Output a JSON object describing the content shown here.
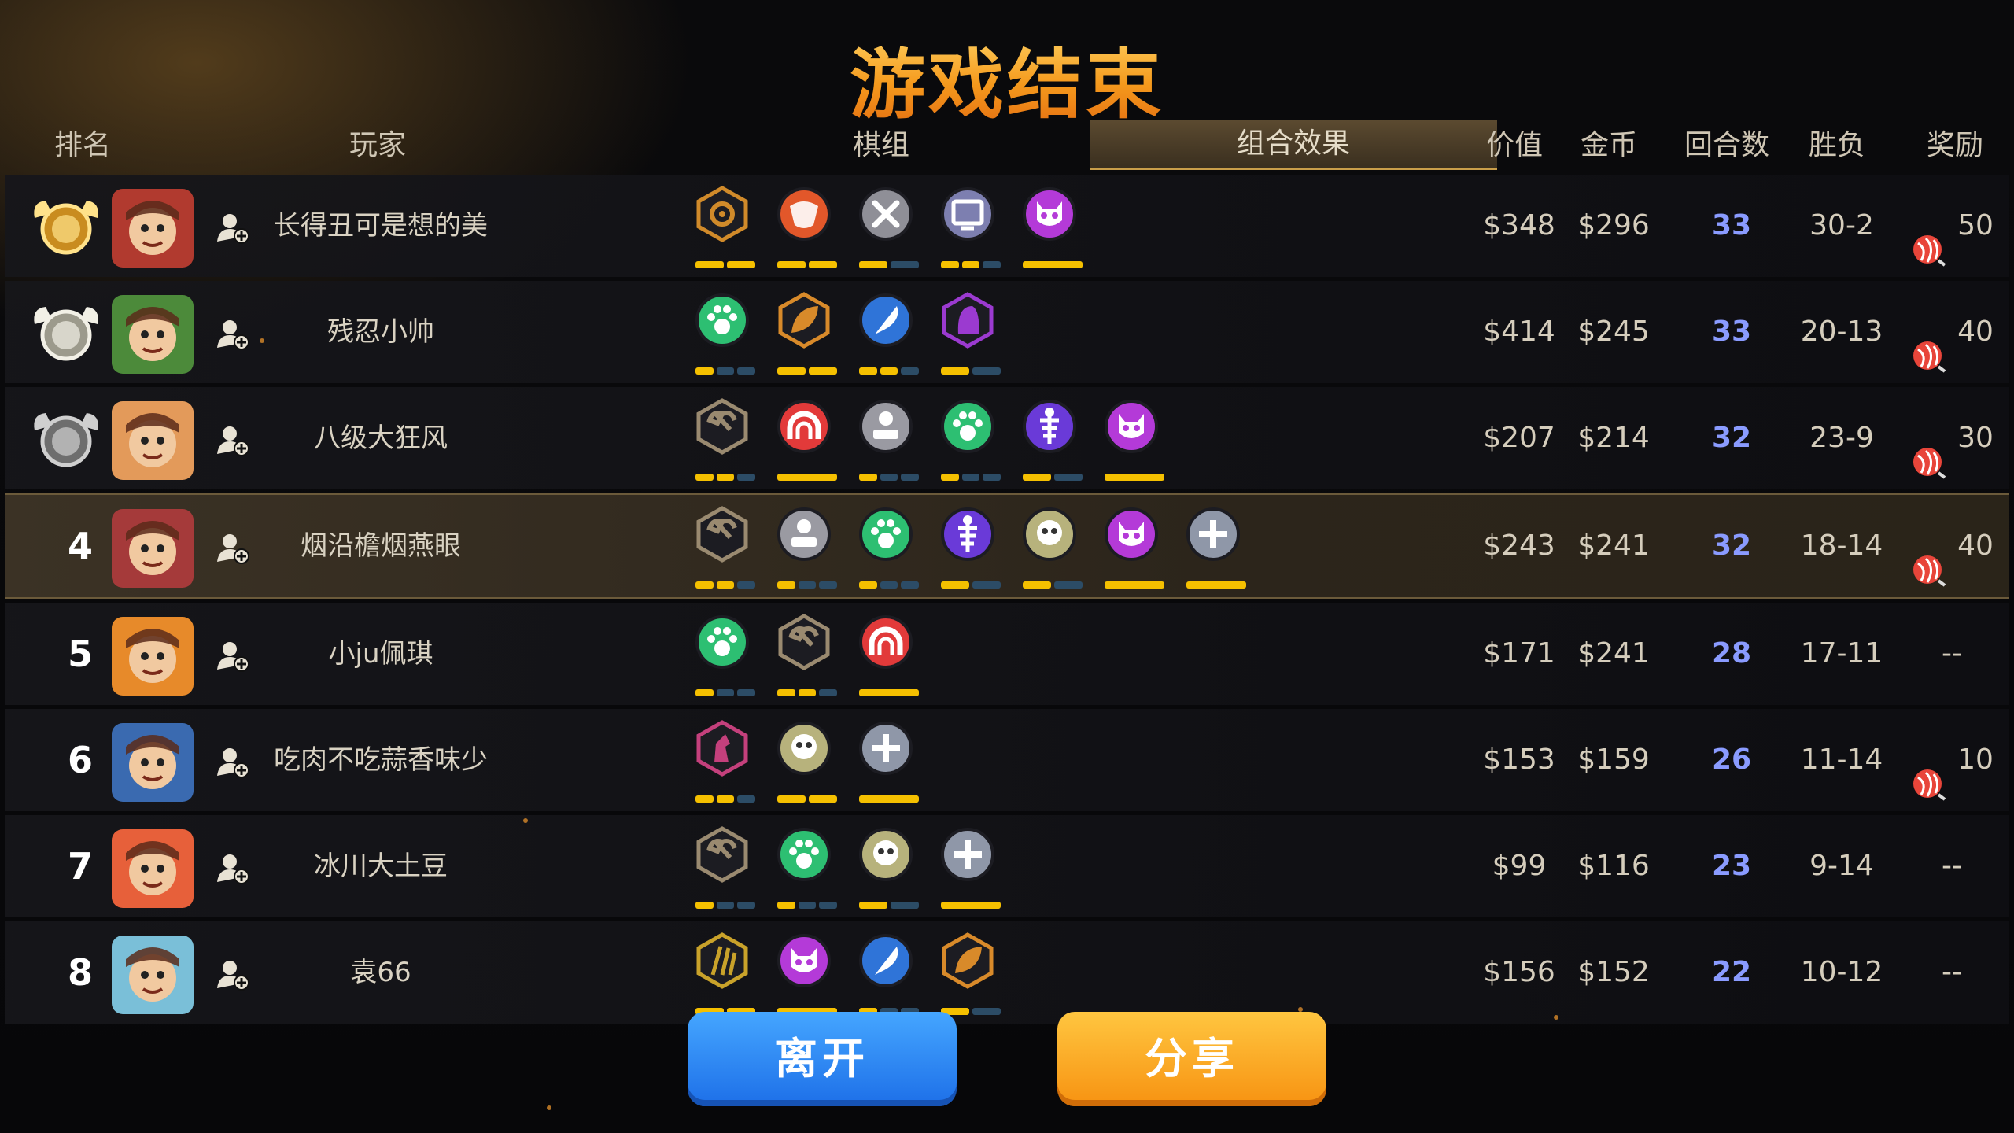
{
  "title": "游戏结束",
  "headers": {
    "rank": "排名",
    "player": "玩家",
    "pieces": "棋组",
    "combo": "组合效果",
    "value": "价值",
    "gold": "金币",
    "rounds": "回合数",
    "winloss": "胜负",
    "reward": "奖励"
  },
  "colors": {
    "accent": "#f59a1d",
    "round_text": "#8a9bff",
    "bar_on": "#f5c000",
    "bar_off": "#2c4c66",
    "leave_button": "#1d6fe8",
    "share_button": "#f79211"
  },
  "rows": [
    {
      "rank": "1",
      "rank_icon": "gold-medal-icon",
      "name": "长得丑可是想的美",
      "value": "$348",
      "gold": "$296",
      "rounds": "33",
      "winloss": "30-2",
      "reward": "50",
      "has_reward": true,
      "pieces": [
        {
          "icon": "gear-icon",
          "color": "#d08a2a",
          "shape": "hex",
          "bars": [
            2,
            2
          ]
        },
        {
          "icon": "demon-horn-icon",
          "color": "#e2572a",
          "shape": "circle",
          "bars": [
            2,
            2
          ]
        },
        {
          "icon": "crossed-tools-icon",
          "color": "#8f8f97",
          "shape": "circle",
          "bars": [
            1,
            2
          ]
        },
        {
          "icon": "monitor-icon",
          "color": "#7d7fb0",
          "shape": "circle",
          "bars": [
            2,
            3
          ]
        },
        {
          "icon": "demon-face-icon",
          "color": "#b43ad8",
          "shape": "circle",
          "bars": [
            1,
            1
          ]
        }
      ]
    },
    {
      "rank": "2",
      "rank_icon": "silver-medal-icon",
      "name": "残忍小帅",
      "value": "$414",
      "gold": "$245",
      "rounds": "33",
      "winloss": "20-13",
      "reward": "40",
      "has_reward": true,
      "pieces": [
        {
          "icon": "paw-icon",
          "color": "#2dbf72",
          "shape": "circle",
          "bars": [
            1,
            3
          ]
        },
        {
          "icon": "leaf-icon",
          "color": "#d88a2a",
          "shape": "hex",
          "bars": [
            2,
            2
          ]
        },
        {
          "icon": "feather-icon",
          "color": "#2f74d8",
          "shape": "circle",
          "bars": [
            2,
            3
          ]
        },
        {
          "icon": "hood-icon",
          "color": "#9b3ad0",
          "shape": "hex",
          "bars": [
            1,
            2
          ]
        }
      ]
    },
    {
      "rank": "3",
      "rank_icon": "bronze-medal-icon",
      "name": "八级大狂风",
      "value": "$207",
      "gold": "$214",
      "rounds": "32",
      "winloss": "23-9",
      "reward": "30",
      "has_reward": true,
      "pieces": [
        {
          "icon": "axe-icon",
          "color": "#9a8a70",
          "shape": "hex",
          "bars": [
            2,
            3
          ]
        },
        {
          "icon": "arch-icon",
          "color": "#e23a3a",
          "shape": "circle",
          "bars": [
            1,
            1
          ]
        },
        {
          "icon": "pedestal-icon",
          "color": "#9a9aa2",
          "shape": "circle",
          "bars": [
            1,
            3
          ]
        },
        {
          "icon": "paw-icon",
          "color": "#2dbf72",
          "shape": "circle",
          "bars": [
            1,
            3
          ]
        },
        {
          "icon": "fishbone-icon",
          "color": "#6a3ad8",
          "shape": "circle",
          "bars": [
            1,
            2
          ]
        },
        {
          "icon": "demon-face-icon",
          "color": "#b43ad8",
          "shape": "circle",
          "bars": [
            1,
            1
          ]
        }
      ]
    },
    {
      "rank": "4",
      "rank_icon": "",
      "name": "烟沿檐烟燕眼",
      "value": "$243",
      "gold": "$241",
      "rounds": "32",
      "winloss": "18-14",
      "reward": "40",
      "has_reward": true,
      "pieces": [
        {
          "icon": "axe-icon",
          "color": "#9a8a70",
          "shape": "hex",
          "bars": [
            2,
            3
          ]
        },
        {
          "icon": "pedestal-icon",
          "color": "#9a9aa2",
          "shape": "circle",
          "bars": [
            1,
            3
          ]
        },
        {
          "icon": "paw-icon",
          "color": "#2dbf72",
          "shape": "circle",
          "bars": [
            1,
            3
          ]
        },
        {
          "icon": "fishbone-icon",
          "color": "#6a3ad8",
          "shape": "circle",
          "bars": [
            1,
            2
          ]
        },
        {
          "icon": "skull-mask-icon",
          "color": "#b7b27c",
          "shape": "circle",
          "bars": [
            1,
            2
          ]
        },
        {
          "icon": "demon-face-icon",
          "color": "#b43ad8",
          "shape": "circle",
          "bars": [
            1,
            1
          ]
        },
        {
          "icon": "cross-icon",
          "color": "#8f97a8",
          "shape": "circle",
          "bars": [
            1,
            1
          ]
        }
      ]
    },
    {
      "rank": "5",
      "rank_icon": "",
      "name": "小ju佩琪",
      "value": "$171",
      "gold": "$241",
      "rounds": "28",
      "winloss": "17-11",
      "reward": "--",
      "has_reward": false,
      "pieces": [
        {
          "icon": "paw-icon",
          "color": "#2dbf72",
          "shape": "circle",
          "bars": [
            1,
            3
          ]
        },
        {
          "icon": "axe-icon",
          "color": "#9a8a70",
          "shape": "hex",
          "bars": [
            2,
            3
          ]
        },
        {
          "icon": "arch-icon",
          "color": "#e23a3a",
          "shape": "circle",
          "bars": [
            1,
            1
          ]
        }
      ]
    },
    {
      "rank": "6",
      "rank_icon": "",
      "name": "吃肉不吃蒜香味少",
      "value": "$153",
      "gold": "$159",
      "rounds": "26",
      "winloss": "11-14",
      "reward": "10",
      "has_reward": true,
      "pieces": [
        {
          "icon": "knight-icon",
          "color": "#c4407c",
          "shape": "hex",
          "bars": [
            2,
            3
          ]
        },
        {
          "icon": "skull-mask-icon",
          "color": "#b7b27c",
          "shape": "circle",
          "bars": [
            2,
            2
          ]
        },
        {
          "icon": "cross-icon",
          "color": "#8f97a8",
          "shape": "circle",
          "bars": [
            1,
            1
          ]
        }
      ]
    },
    {
      "rank": "7",
      "rank_icon": "",
      "name": "冰川大土豆",
      "value": "$99",
      "gold": "$116",
      "rounds": "23",
      "winloss": "9-14",
      "reward": "--",
      "has_reward": false,
      "pieces": [
        {
          "icon": "axe-icon",
          "color": "#9a8a70",
          "shape": "hex",
          "bars": [
            1,
            3
          ]
        },
        {
          "icon": "paw-icon",
          "color": "#2dbf72",
          "shape": "circle",
          "bars": [
            1,
            3
          ]
        },
        {
          "icon": "skull-mask-icon",
          "color": "#b7b27c",
          "shape": "circle",
          "bars": [
            1,
            2
          ]
        },
        {
          "icon": "cross-icon",
          "color": "#8f97a8",
          "shape": "circle",
          "bars": [
            1,
            1
          ]
        }
      ]
    },
    {
      "rank": "8",
      "rank_icon": "",
      "name": "袁66",
      "value": "$156",
      "gold": "$152",
      "rounds": "22",
      "winloss": "10-12",
      "reward": "--",
      "has_reward": false,
      "pieces": [
        {
          "icon": "claw-icon",
          "color": "#c9a22a",
          "shape": "hex",
          "bars": [
            2,
            2
          ]
        },
        {
          "icon": "demon-face-icon",
          "color": "#b43ad8",
          "shape": "circle",
          "bars": [
            1,
            1
          ]
        },
        {
          "icon": "feather-icon",
          "color": "#2f74d8",
          "shape": "circle",
          "bars": [
            1,
            3
          ]
        },
        {
          "icon": "leaf-icon",
          "color": "#d88a2a",
          "shape": "hex",
          "bars": [
            1,
            2
          ]
        }
      ]
    }
  ],
  "buttons": {
    "leave": "离开",
    "share": "分享"
  }
}
